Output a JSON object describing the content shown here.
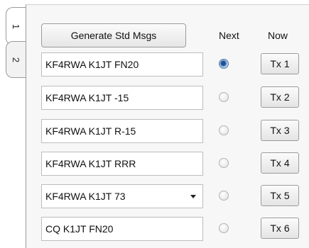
{
  "tabs": [
    {
      "label": "1",
      "active": true
    },
    {
      "label": "2",
      "active": false
    }
  ],
  "toolbar": {
    "generate_label": "Generate Std Msgs",
    "next_header": "Next",
    "now_header": "Now"
  },
  "rows": [
    {
      "message": "KF4RWA K1JT FN20",
      "tx_label": "Tx 1",
      "next_selected": true
    },
    {
      "message": "KF4RWA K1JT -15",
      "tx_label": "Tx 2",
      "next_selected": false
    },
    {
      "message": "KF4RWA K1JT R-15",
      "tx_label": "Tx 3",
      "next_selected": false
    },
    {
      "message": "KF4RWA K1JT RRR",
      "tx_label": "Tx 4",
      "next_selected": false
    },
    {
      "message": "KF4RWA K1JT 73",
      "tx_label": "Tx 5",
      "next_selected": false,
      "dropdown": true
    },
    {
      "message": "CQ K1JT FN20",
      "tx_label": "Tx 6",
      "next_selected": false
    }
  ]
}
